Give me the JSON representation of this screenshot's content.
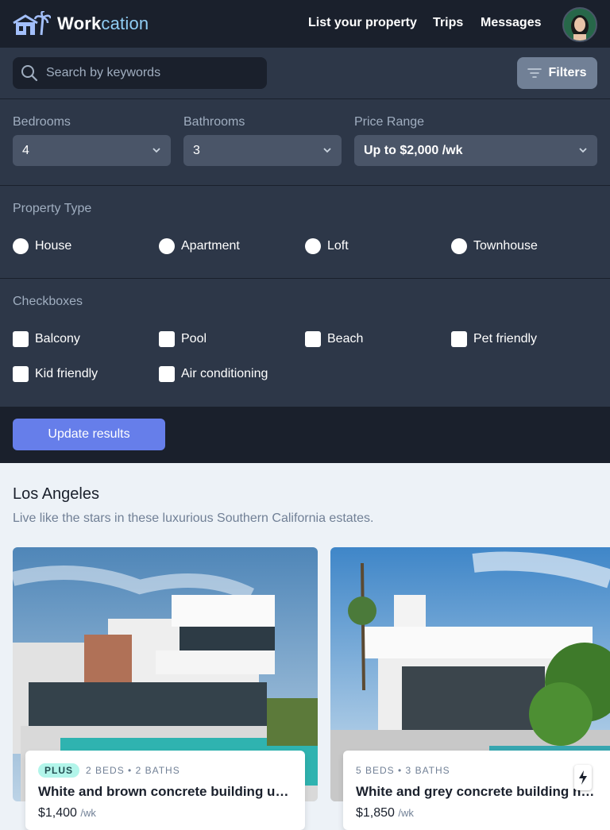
{
  "brand": {
    "name_main": "Work",
    "name_accent": "cation"
  },
  "nav": {
    "list_property": "List your property",
    "trips": "Trips",
    "messages": "Messages"
  },
  "search": {
    "placeholder": "Search by keywords",
    "value": ""
  },
  "filters_button": "Filters",
  "filters": {
    "bedrooms": {
      "label": "Bedrooms",
      "value": "4"
    },
    "bathrooms": {
      "label": "Bathrooms",
      "value": "3"
    },
    "price": {
      "label": "Price Range",
      "value": "Up to $2,000 /wk"
    },
    "property_type": {
      "label": "Property Type",
      "options": [
        "House",
        "Apartment",
        "Loft",
        "Townhouse"
      ]
    },
    "checkboxes": {
      "label": "Checkboxes",
      "options": [
        "Balcony",
        "Pool",
        "Beach",
        "Pet friendly",
        "Kid friendly",
        "Air conditioning"
      ]
    }
  },
  "update_button": "Update results",
  "section": {
    "city": "Los Angeles",
    "description": "Live like the stars in these luxurious Southern California estates.",
    "listings": [
      {
        "badge": "PLUS",
        "meta": "2 BEDS • 2 BATHS",
        "title": "White and brown concrete building under blue sky",
        "price": "$1,400",
        "per": "/wk"
      },
      {
        "badge": "",
        "meta": "5 BEDS • 3 BATHS",
        "title": "White and grey concrete building near swimming pool",
        "price": "$1,850",
        "per": "/wk"
      }
    ]
  },
  "colors": {
    "header": "#1a202c",
    "panel": "#2d3748",
    "accent": "#667eea",
    "badge": "#b2f5ea"
  }
}
